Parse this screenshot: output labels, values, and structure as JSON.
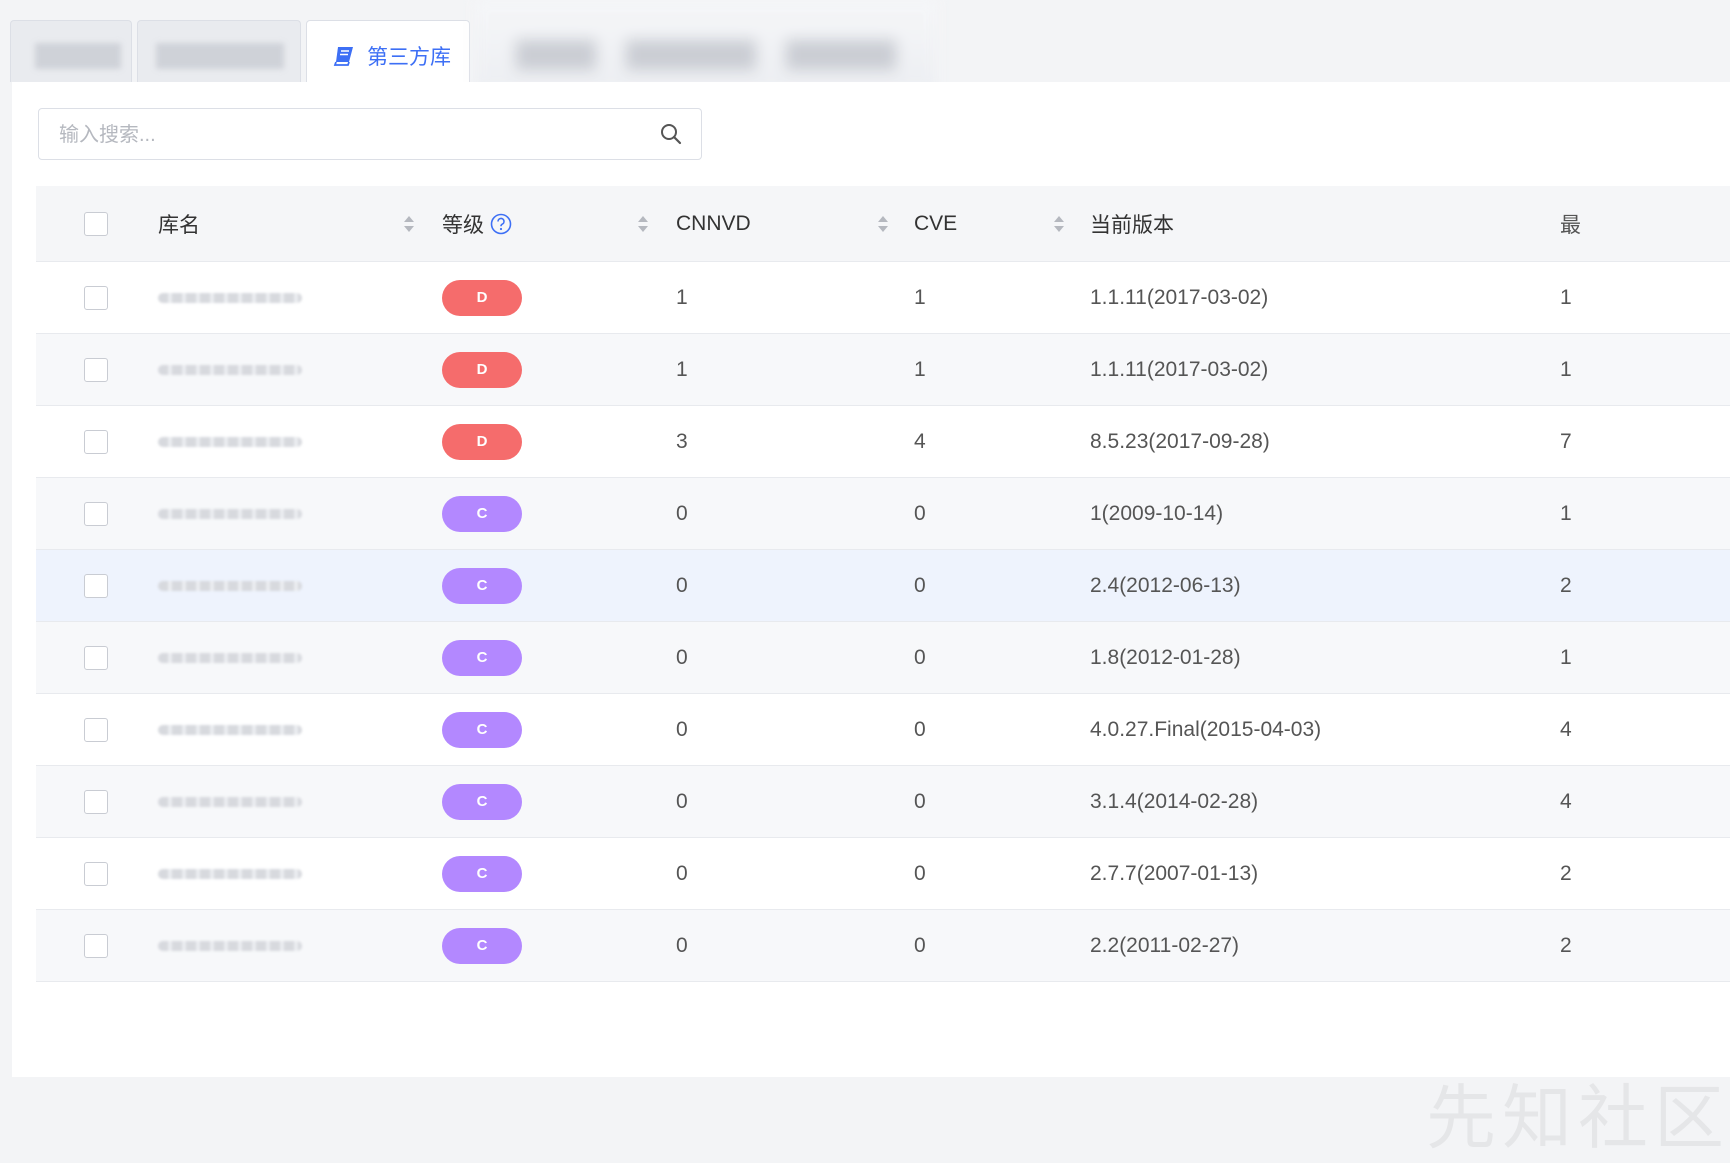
{
  "tabs": [
    {
      "label": "",
      "blurred": true
    },
    {
      "label": "",
      "blurred": true
    },
    {
      "label": "第三方库",
      "active": true,
      "icon": "book-icon"
    },
    {
      "label": "",
      "blurred": true
    }
  ],
  "search": {
    "placeholder": "输入搜索...",
    "value": ""
  },
  "table": {
    "columns": [
      "库名",
      "等级",
      "CNNVD",
      "CVE",
      "当前版本",
      "最"
    ],
    "rows": [
      {
        "grade": "D",
        "cnnvd": "1",
        "cve": "1",
        "version": "1.1.11(2017-03-02)",
        "latest": "1"
      },
      {
        "grade": "D",
        "cnnvd": "1",
        "cve": "1",
        "version": "1.1.11(2017-03-02)",
        "latest": "1"
      },
      {
        "grade": "D",
        "cnnvd": "3",
        "cve": "4",
        "version": "8.5.23(2017-09-28)",
        "latest": "7"
      },
      {
        "grade": "C",
        "cnnvd": "0",
        "cve": "0",
        "version": "1(2009-10-14)",
        "latest": "1"
      },
      {
        "grade": "C",
        "cnnvd": "0",
        "cve": "0",
        "version": "2.4(2012-06-13)",
        "latest": "2"
      },
      {
        "grade": "C",
        "cnnvd": "0",
        "cve": "0",
        "version": "1.8(2012-01-28)",
        "latest": "1"
      },
      {
        "grade": "C",
        "cnnvd": "0",
        "cve": "0",
        "version": "4.0.27.Final(2015-04-03)",
        "latest": "4"
      },
      {
        "grade": "C",
        "cnnvd": "0",
        "cve": "0",
        "version": "3.1.4(2014-02-28)",
        "latest": "4"
      },
      {
        "grade": "C",
        "cnnvd": "0",
        "cve": "0",
        "version": "2.7.7(2007-01-13)",
        "latest": "2"
      },
      {
        "grade": "C",
        "cnnvd": "0",
        "cve": "0",
        "version": "2.2(2011-02-27)",
        "latest": "2"
      }
    ]
  },
  "colors": {
    "accent": "#3d6ff5",
    "grade_D": "#f56c6c",
    "grade_C": "#b388ff"
  },
  "watermark": "先知社区"
}
